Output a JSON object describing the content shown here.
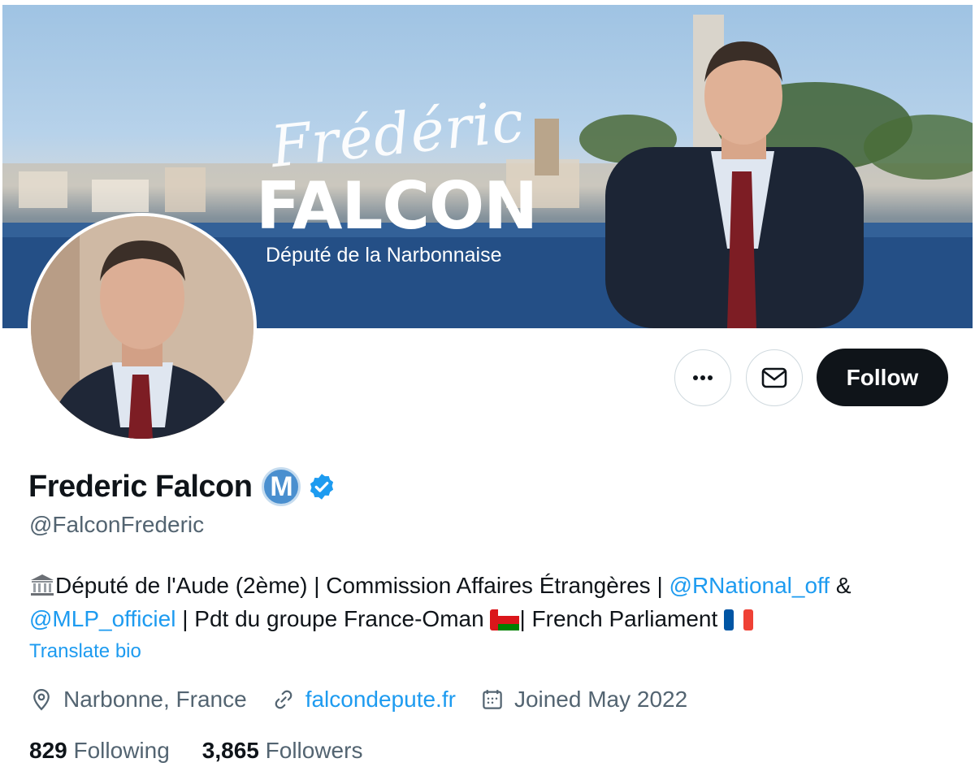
{
  "banner": {
    "script_name": "Frédéric",
    "big_name": "FALCON",
    "subtitle": "Député de la Narbonnaise"
  },
  "actions": {
    "more_icon": "more-icon",
    "message_icon": "envelope-icon",
    "follow_label": "Follow"
  },
  "profile": {
    "display_name": "Frederic Falcon",
    "badge_letter": "M",
    "handle": "@FalconFrederic",
    "bio": {
      "part1": "Député de l'Aude (2ème) | Commission Affaires Étrangères |",
      "mention1": "@RNational_off",
      "amp": "&",
      "mention2": "@MLP_officiel",
      "part2": "| Pdt du groupe France-Oman",
      "part3": "| French Parliament"
    },
    "translate_label": "Translate bio",
    "location": "Narbonne, France",
    "website": "falcondepute.fr",
    "joined": "Joined May 2022",
    "following_count": "829",
    "following_label": "Following",
    "followers_count": "3,865",
    "followers_label": "Followers"
  },
  "colors": {
    "accent": "#1d9bf0",
    "text": "#0f1419",
    "muted": "#536471",
    "follow_bg": "#0f1419"
  }
}
